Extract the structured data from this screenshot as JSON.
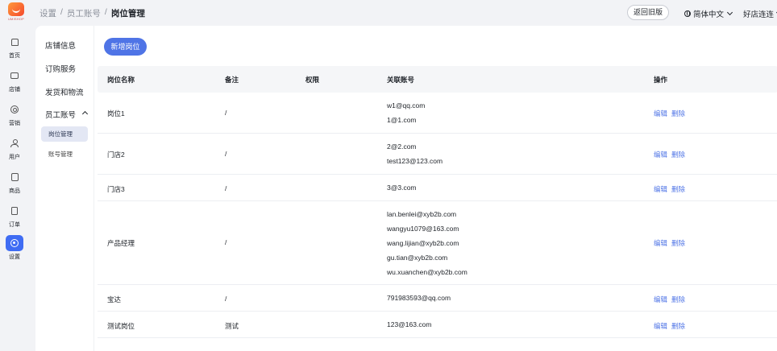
{
  "app": {
    "logo_text": "UMISHOP"
  },
  "breadcrumb": {
    "items": [
      "设置",
      "员工账号",
      "岗位管理"
    ],
    "sep": "/"
  },
  "header": {
    "old_version_label": "返回旧版",
    "language": "简体中文",
    "shop_name": "好店连连"
  },
  "rail": {
    "items": [
      {
        "label": "首页",
        "icon": "home-icon"
      },
      {
        "label": "店铺",
        "icon": "store-icon"
      },
      {
        "label": "营销",
        "icon": "marketing-icon"
      },
      {
        "label": "用户",
        "icon": "user-icon"
      },
      {
        "label": "商品",
        "icon": "goods-icon"
      },
      {
        "label": "订单",
        "icon": "order-icon"
      },
      {
        "label": "设置",
        "icon": "settings-icon",
        "active": true
      }
    ]
  },
  "submenu": {
    "items": [
      "店铺信息",
      "订购服务",
      "发货和物流"
    ],
    "group": {
      "label": "员工账号",
      "children": [
        "岗位管理",
        "账号管理"
      ],
      "active_child": "岗位管理"
    }
  },
  "main": {
    "new_button": "新增岗位",
    "columns": [
      "岗位名称",
      "备注",
      "权限",
      "关联账号",
      "操作"
    ],
    "edit_label": "编辑",
    "delete_label": "删除",
    "rows": [
      {
        "name": "岗位1",
        "remark": "/",
        "perm": "",
        "accounts": [
          "w1@qq.com",
          "1@1.com"
        ]
      },
      {
        "name": "门店2",
        "remark": "/",
        "perm": "",
        "accounts": [
          "2@2.com",
          "test123@123.com"
        ]
      },
      {
        "name": "门店3",
        "remark": "/",
        "perm": "",
        "accounts": [
          "3@3.com"
        ]
      },
      {
        "name": "产品经理",
        "remark": "/",
        "perm": "",
        "accounts": [
          "lan.benlei@xyb2b.com",
          "wangyu1079@163.com",
          "wang.lijian@xyb2b.com",
          "gu.tian@xyb2b.com",
          "wu.xuanchen@xyb2b.com"
        ]
      },
      {
        "name": "宝达",
        "remark": "/",
        "perm": "",
        "accounts": [
          "791983593@qq.com"
        ]
      },
      {
        "name": "测试岗位",
        "remark": "测试",
        "perm": "",
        "accounts": [
          "123@163.com"
        ]
      }
    ]
  },
  "colors": {
    "accent": "#4f74e6",
    "active_nav": "#3f6cf3",
    "page_bg": "#f2f3f6"
  }
}
